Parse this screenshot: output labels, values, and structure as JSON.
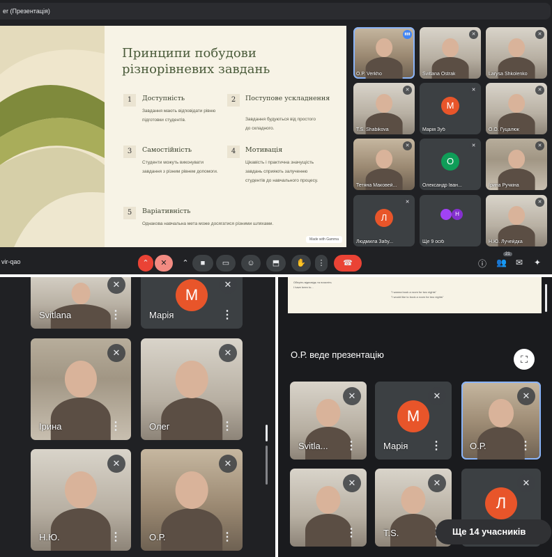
{
  "window": {
    "title": "er (Презентація)",
    "meeting_code": "vir-qao"
  },
  "slide": {
    "title": "Принципи побудови різнорівневих завдань",
    "points": [
      {
        "num": "1",
        "heading": "Доступність",
        "desc": "Завдання мають відповідати рівню підготовки студентів."
      },
      {
        "num": "2",
        "heading": "Поступове ускладнення",
        "desc": "Завдання будуються від простого до складного."
      },
      {
        "num": "3",
        "heading": "Самостійність",
        "desc": "Студенти можуть виконувати завдання з різним рівнем допомоги."
      },
      {
        "num": "4",
        "heading": "Мотивація",
        "desc": "Цікавість і практична значущість завдань сприяють залученню студентів до навчального процесу."
      },
      {
        "num": "5",
        "heading": "Варіативність",
        "desc": "Однакова навчальна мета може досягатися різними шляхами."
      }
    ],
    "badge": "Made with Gamma"
  },
  "grid_top": [
    {
      "name": "O.P. Verkho",
      "type": "cam",
      "mic": "speaking"
    },
    {
      "name": "Svitlana Ostrak",
      "type": "cam",
      "mic": "muted"
    },
    {
      "name": "Larysa Shkolenko",
      "type": "cam",
      "mic": "muted"
    },
    {
      "name": "T.S. Shabikova",
      "type": "cam",
      "mic": "muted"
    },
    {
      "name": "Марія Зуб",
      "type": "avatar",
      "letter": "М",
      "color": "#e8552a",
      "mic": "muted"
    },
    {
      "name": "О.О. Гуцалюк",
      "type": "cam",
      "mic": "muted"
    },
    {
      "name": "Тетяна Маковей...",
      "type": "cam",
      "mic": "muted"
    },
    {
      "name": "Олександр Іван...",
      "type": "avatar",
      "letter": "О",
      "color": "#0f9d58",
      "mic": "muted"
    },
    {
      "name": "Ірина Ручкіна",
      "type": "cam",
      "mic": "muted"
    },
    {
      "name": "Людмила Забу...",
      "type": "avatar",
      "letter": "Л",
      "color": "#e8552a",
      "mic": "muted"
    },
    {
      "name": "Ще 9 осіб",
      "type": "more",
      "mic": "none"
    },
    {
      "name": "Н.Ю. Лучейдка",
      "type": "cam",
      "mic": "muted"
    }
  ],
  "more_letters": [
    "Н"
  ],
  "controls": {
    "participants_count": "21"
  },
  "grid_left": [
    {
      "name": "Svitlana",
      "type": "cam"
    },
    {
      "name": "Марія",
      "type": "avatar",
      "letter": "М",
      "color": "#e8552a"
    },
    {
      "name": "Ірина",
      "type": "cam"
    },
    {
      "name": "Олег",
      "type": "cam"
    },
    {
      "name": "Н.Ю.",
      "type": "cam"
    },
    {
      "name": "О.Р.",
      "type": "cam"
    }
  ],
  "right_panel": {
    "presenting_label": "О.Р. веде презентацію",
    "tiles": [
      {
        "name": "Svitla...",
        "type": "cam"
      },
      {
        "name": "Марія",
        "type": "avatar",
        "letter": "М",
        "color": "#e8552a"
      },
      {
        "name": "О.Р.",
        "type": "cam"
      },
      {
        "name": "",
        "type": "cam"
      },
      {
        "name": "T.S.",
        "type": "cam"
      },
      {
        "name": "",
        "type": "avatar",
        "letter": "Л",
        "color": "#e8552a"
      }
    ],
    "more_label": "Ще 14 учасників",
    "pres_snippet": [
      "Оберіть відповідь та поясніть",
      "I have been to...",
      "\"I wanna book a room for two nights\"",
      "\"I would like to book a room for two nights\""
    ]
  }
}
